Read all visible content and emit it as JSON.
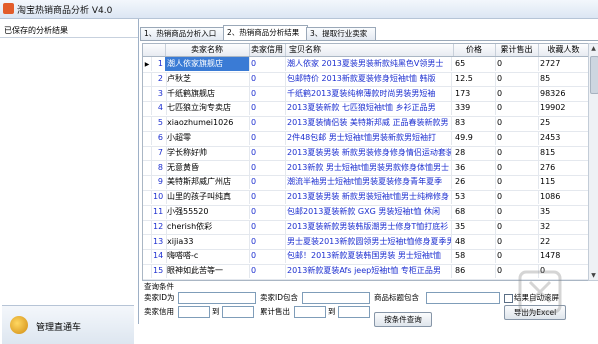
{
  "window": {
    "title": "淘宝热销商品分析 V4.0"
  },
  "left_panel": {
    "header": "已保存的分析结果",
    "manage_button": "管理直通车"
  },
  "tabs": [
    "1、热销商品分析入口",
    "2、热销商品分析结果",
    "3、提取行业卖家"
  ],
  "table": {
    "columns": [
      "卖家名称",
      "卖家信用",
      "宝贝名称",
      "价格",
      "累计售出",
      "收藏人数"
    ],
    "rows": [
      {
        "idx": "1",
        "name": "潮人依家旗舰店",
        "credit": "0",
        "title": "潮人依家 2013夏装男装新款纯黑色V领男士",
        "price": "65",
        "sold": "0",
        "fav": "2727"
      },
      {
        "idx": "2",
        "name": "卢秋芝",
        "credit": "0",
        "title": "包邮特价 2013新款夏装修身短袖t恤 韩版",
        "price": "12.5",
        "sold": "0",
        "fav": "85"
      },
      {
        "idx": "3",
        "name": "千纸鹤旗舰店",
        "credit": "0",
        "title": "千纸鹤2013夏装纯棉薄款时尚男装男短袖",
        "price": "173",
        "sold": "0",
        "fav": "98326"
      },
      {
        "idx": "4",
        "name": "七匹狼立洵专卖店",
        "credit": "0",
        "title": "2013夏装新款 七匹狼短袖t恤 乡衫正品男",
        "price": "339",
        "sold": "0",
        "fav": "19902"
      },
      {
        "idx": "5",
        "name": "xiaozhumei1026",
        "credit": "0",
        "title": "2013夏装情侣装 美特斯邦威 正品春装新款男",
        "price": "83",
        "sold": "0",
        "fav": "25"
      },
      {
        "idx": "6",
        "name": "小超零",
        "credit": "0",
        "title": "2件48包邮 男士短袖t恤男装新款男短袖打",
        "price": "49.9",
        "sold": "0",
        "fav": "2453"
      },
      {
        "idx": "7",
        "name": "学长称好帅",
        "credit": "0",
        "title": "2013夏装男装 新款男装修身修身情侣运动套装",
        "price": "28",
        "sold": "0",
        "fav": "815"
      },
      {
        "idx": "8",
        "name": "无意黄昏",
        "credit": "0",
        "title": "2013新款 男士短袖t恤男装男款修身体恤男士",
        "price": "36",
        "sold": "0",
        "fav": "276"
      },
      {
        "idx": "9",
        "name": "美特斯邦威广州店",
        "credit": "0",
        "title": "潮流半袖男士短袖t恤男装夏装修身青年夏季",
        "price": "26",
        "sold": "0",
        "fav": "115"
      },
      {
        "idx": "10",
        "name": "山里的孩子叫纯真",
        "credit": "0",
        "title": "2013夏装男装 新款男装短袖t恤男士纯棉修身",
        "price": "53",
        "sold": "0",
        "fav": "1086"
      },
      {
        "idx": "11",
        "name": "小强55520",
        "credit": "0",
        "title": "包邮2013夏装新款 GXG 男装短袖t恤 休闲",
        "price": "68",
        "sold": "0",
        "fav": "35"
      },
      {
        "idx": "12",
        "name": "cherish依彩",
        "credit": "0",
        "title": "2013夏装新款男装韩版潮男士修身T恤打底衫",
        "price": "35",
        "sold": "0",
        "fav": "32"
      },
      {
        "idx": "13",
        "name": "xijia33",
        "credit": "0",
        "title": "男士夏装2013新款圆领男士短袖t恤修身夏季男",
        "price": "48",
        "sold": "0",
        "fav": "22"
      },
      {
        "idx": "14",
        "name": "嗨嗒嗒-c",
        "credit": "0",
        "title": "包邮！2013新款夏装韩国男装 男士短袖t恤",
        "price": "58",
        "sold": "0",
        "fav": "1478"
      },
      {
        "idx": "15",
        "name": "眼神如此苦等一",
        "credit": "0",
        "title": "2013新款夏装Afs jeep短袖t恤 专柜正品男",
        "price": "86",
        "sold": "0",
        "fav": "0"
      }
    ]
  },
  "query": {
    "section_label": "查询条件",
    "seller_id_label": "卖家ID为",
    "seller_id_contains_label": "卖家ID包含",
    "title_contains_label": "商品标题包含",
    "credit_label": "卖家信用",
    "to_label_1": "到",
    "sold_label": "累计售出",
    "to_label_2": "到",
    "search_button": "按条件查询",
    "auto_scroll_label": "结果自动滚屏",
    "export_button": "导出为Excel"
  },
  "colors": {
    "selected_row": "#3a7bd5",
    "link_text": "#1d2fd0"
  }
}
